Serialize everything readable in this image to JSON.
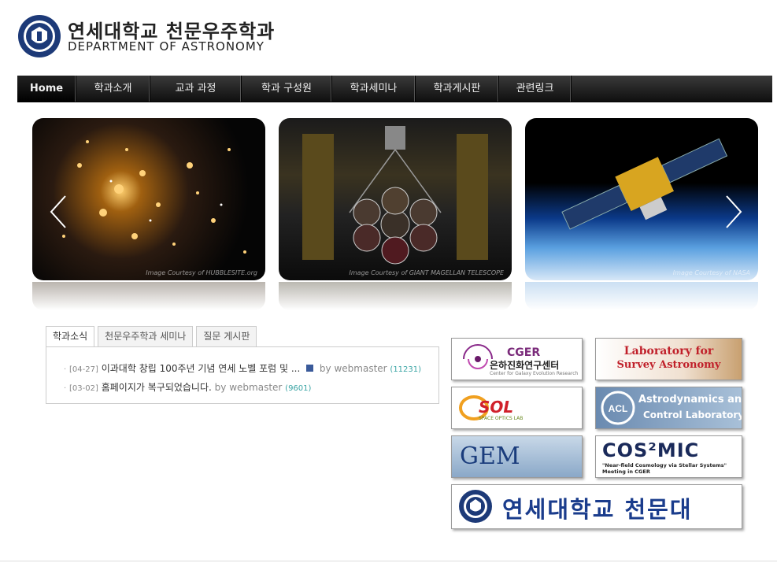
{
  "header": {
    "title_kr": "연세대학교 천문우주학과",
    "title_en": "DEPARTMENT OF ASTRONOMY"
  },
  "nav": {
    "items": [
      {
        "label": "Home"
      },
      {
        "label": "학과소개"
      },
      {
        "label": "교과 과정"
      },
      {
        "label": "학과 구성원"
      },
      {
        "label": "학과세미나"
      },
      {
        "label": "학과게시판"
      },
      {
        "label": "관련링크"
      }
    ]
  },
  "slider": {
    "slides": [
      {
        "credit": "Image Courtesy of HUBBLESITE.org"
      },
      {
        "credit": "Image Courtesy of GIANT MAGELLAN TELESCOPE"
      },
      {
        "credit": "Image Courtesy of NASA"
      }
    ]
  },
  "tabs": [
    {
      "label": "학과소식"
    },
    {
      "label": "천문우주학과 세미나"
    },
    {
      "label": "질문 게시판"
    }
  ],
  "posts": [
    {
      "date": "[04-27]",
      "title": "이과대학 창립 100주년 기념 연세 노벨 포럼 및 ...",
      "by": "by webmaster",
      "count": "(11231)"
    },
    {
      "date": "[03-02]",
      "title": "홈페이지가 복구되었습니다.",
      "by": "by webmaster",
      "count": "(9601)"
    }
  ],
  "banners": {
    "cger_title": "CGER",
    "cger_kr": "은하진화연구센터",
    "cger_sub": "Center for Galaxy Evolution Research",
    "lsa_line1": "Laboratory for",
    "lsa_line2": "Survey Astronomy",
    "sol_title": "SOL",
    "sol_sub": "SPACE OPTICS LAB",
    "acl_line1": "Astrodynamics and",
    "acl_line2": "Control Laboratory",
    "gem": "GEM",
    "cosmic_title": "COS²MIC",
    "cosmic_sub1": "\"Near-field Cosmology via Stellar Systems\"",
    "cosmic_sub2": "Meeting in CGER",
    "observatory": "연세대학교 천문대"
  },
  "colors": {
    "nav_bg": "#1a1a1a",
    "count_teal": "#3aa4a4",
    "observatory_blue": "#1a3c8c"
  }
}
